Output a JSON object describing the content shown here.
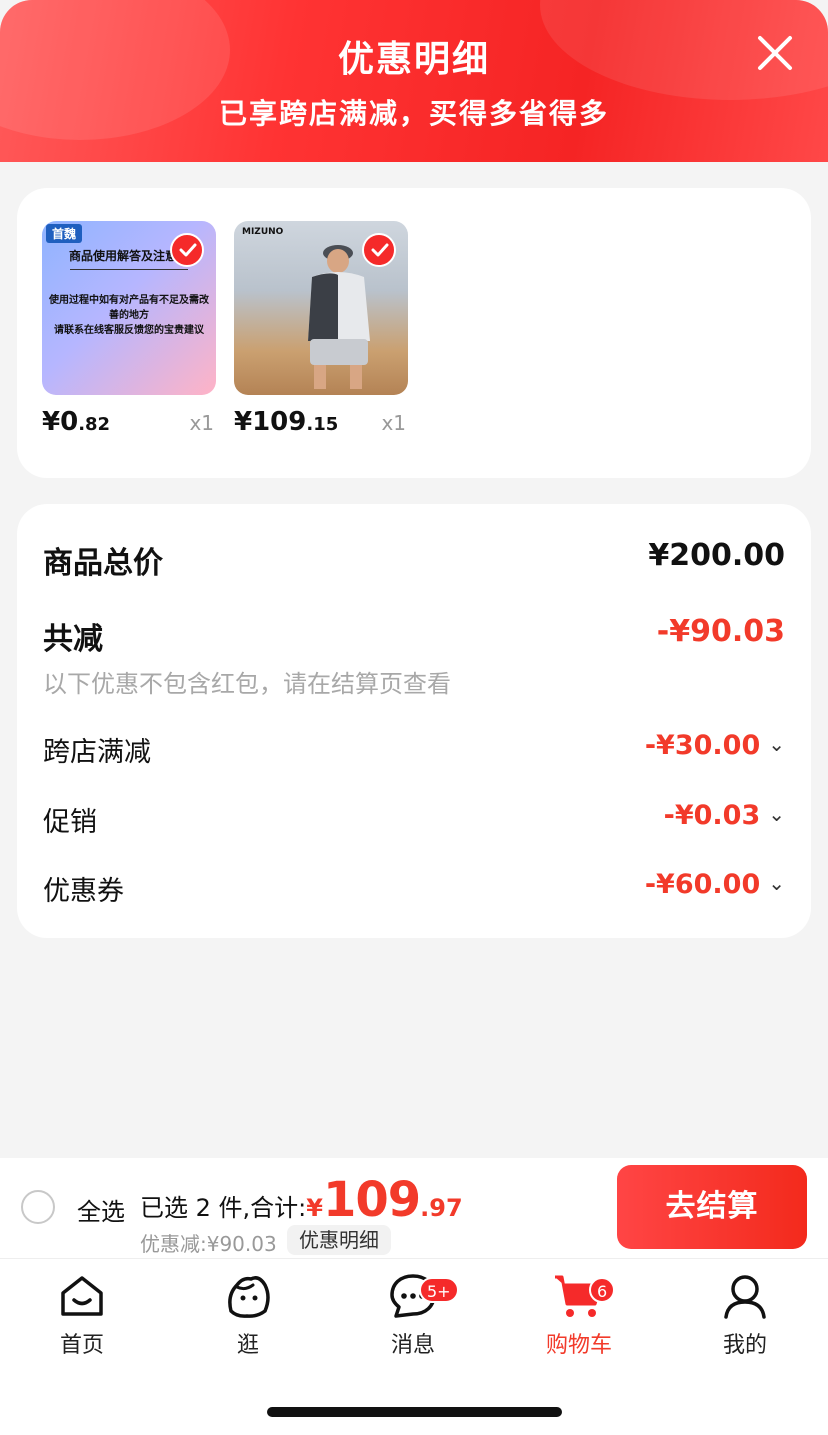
{
  "header": {
    "title": "优惠明细",
    "subtitle": "已享跨店满减，买得多省得多"
  },
  "products": [
    {
      "thumb_brand": "首魏",
      "thumb_title": "商品使用解答及注意事",
      "thumb_line1": "使用过程中如有对产品有不足及需改善的地方",
      "thumb_line2": "请联系在线客服反馈您的宝贵建议",
      "price_int": "¥0",
      "price_dec": ".82",
      "qty": "x1",
      "selected": true
    },
    {
      "thumb_brand": "MIZUNO",
      "price_int": "¥109",
      "price_dec": ".15",
      "qty": "x1",
      "selected": true
    }
  ],
  "summary": {
    "total_label": "商品总价",
    "total_value": "¥200.00",
    "reduce_label": "共减",
    "reduce_value": "-¥90.03",
    "note": "以下优惠不包含红包，请在结算页查看",
    "discounts": [
      {
        "label": "跨店满减",
        "value": "-¥30.00"
      },
      {
        "label": "促销",
        "value": "-¥0.03"
      },
      {
        "label": "优惠券",
        "value": "-¥60.00"
      }
    ]
  },
  "checkout_bar": {
    "select_all": "全选",
    "selected_text": "已选 2 件,合计:",
    "currency": "¥",
    "amount_int": "109",
    "amount_dec": ".97",
    "saved_text": "优惠减:¥90.03",
    "detail_tag": "优惠明细",
    "checkout_button": "去结算"
  },
  "tabbar": {
    "items": [
      {
        "label": "首页",
        "icon": "home-icon"
      },
      {
        "label": "逛",
        "icon": "browse-icon"
      },
      {
        "label": "消息",
        "icon": "message-icon",
        "badge": "5+"
      },
      {
        "label": "购物车",
        "icon": "cart-icon",
        "badge": "6",
        "active": true
      },
      {
        "label": "我的",
        "icon": "profile-icon"
      }
    ]
  },
  "colors": {
    "accent": "#f23a2a",
    "header_gradient": "#ff3333",
    "background": "#f4f4f4"
  }
}
